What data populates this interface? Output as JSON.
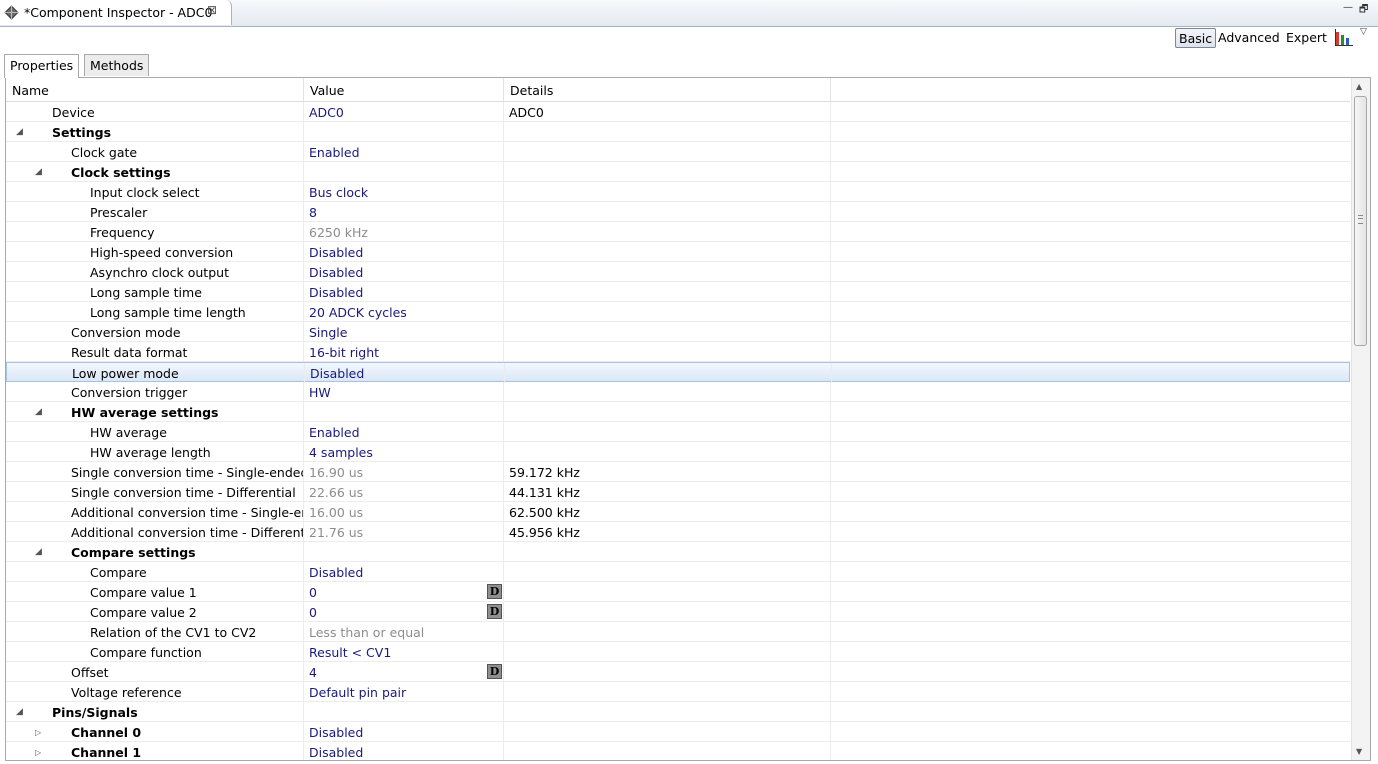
{
  "window": {
    "tab_title": "*Component Inspector - ADC0",
    "close_glyph": "⊠",
    "minimize_glyph": "—",
    "maximize_glyph": "🗗"
  },
  "modes": {
    "basic": "Basic",
    "advanced": "Advanced",
    "expert": "Expert",
    "active": "Basic"
  },
  "subtabs": {
    "properties": "Properties",
    "methods": "Methods"
  },
  "columns": {
    "name": "Name",
    "value": "Value",
    "details": "Details"
  },
  "rows": [
    {
      "name": "Device",
      "level": 2,
      "value": "ADC0",
      "value_style": "edit",
      "details": "ADC0"
    },
    {
      "name": "Settings",
      "level": 2,
      "bold": true,
      "twisty": "open",
      "value": "",
      "details": ""
    },
    {
      "name": "Clock gate",
      "level": 3,
      "value": "Enabled",
      "value_style": "edit",
      "details": ""
    },
    {
      "name": "Clock settings",
      "level": 3,
      "bold": true,
      "twisty": "open",
      "value": "",
      "details": ""
    },
    {
      "name": "Input clock select",
      "level": 4,
      "value": "Bus clock",
      "value_style": "edit",
      "details": ""
    },
    {
      "name": "Prescaler",
      "level": 4,
      "value": "8",
      "value_style": "edit",
      "details": ""
    },
    {
      "name": "Frequency",
      "level": 4,
      "value": "6250 kHz",
      "value_style": "ro",
      "details": ""
    },
    {
      "name": "High-speed conversion",
      "level": 4,
      "value": "Disabled",
      "value_style": "edit",
      "details": ""
    },
    {
      "name": "Asynchro clock output",
      "level": 4,
      "value": "Disabled",
      "value_style": "edit",
      "details": ""
    },
    {
      "name": "Long sample time",
      "level": 4,
      "value": "Disabled",
      "value_style": "edit",
      "details": ""
    },
    {
      "name": "Long sample time length",
      "level": 4,
      "value": "20 ADCK cycles",
      "value_style": "edit",
      "details": ""
    },
    {
      "name": "Conversion mode",
      "level": 3,
      "value": "Single",
      "value_style": "edit",
      "details": ""
    },
    {
      "name": "Result data format",
      "level": 3,
      "value": "16-bit right",
      "value_style": "edit",
      "details": ""
    },
    {
      "name": "Low power mode",
      "level": 3,
      "value": "Disabled",
      "value_style": "edit",
      "details": "",
      "selected": true
    },
    {
      "name": "Conversion trigger",
      "level": 3,
      "value": "HW",
      "value_style": "edit",
      "details": ""
    },
    {
      "name": "HW average settings",
      "level": 3,
      "bold": true,
      "twisty": "open",
      "value": "",
      "details": ""
    },
    {
      "name": "HW average",
      "level": 4,
      "value": "Enabled",
      "value_style": "edit",
      "details": ""
    },
    {
      "name": "HW average length",
      "level": 4,
      "value": "4 samples",
      "value_style": "edit",
      "details": ""
    },
    {
      "name": "Single conversion time - Single-ended",
      "level": 3,
      "value": "16.90 us",
      "value_style": "ro",
      "details": "59.172 kHz"
    },
    {
      "name": "Single conversion time - Differential",
      "level": 3,
      "value": "22.66 us",
      "value_style": "ro",
      "details": "44.131 kHz"
    },
    {
      "name": "Additional conversion time - Single-ended",
      "level": 3,
      "value": "16.00 us",
      "value_style": "ro",
      "details": "62.500 kHz"
    },
    {
      "name": "Additional conversion time - Differential",
      "level": 3,
      "value": "21.76 us",
      "value_style": "ro",
      "details": "45.956 kHz"
    },
    {
      "name": "Compare settings",
      "level": 3,
      "bold": true,
      "twisty": "open",
      "value": "",
      "details": ""
    },
    {
      "name": "Compare",
      "level": 4,
      "value": "Disabled",
      "value_style": "edit",
      "details": ""
    },
    {
      "name": "Compare value 1",
      "level": 4,
      "value": "0",
      "value_style": "edit",
      "details": "",
      "dbutton": "D"
    },
    {
      "name": "Compare value 2",
      "level": 4,
      "value": "0",
      "value_style": "edit",
      "details": "",
      "dbutton": "D"
    },
    {
      "name": "Relation of the CV1 to CV2",
      "level": 4,
      "value": "Less than or equal",
      "value_style": "ro",
      "details": ""
    },
    {
      "name": "Compare function",
      "level": 4,
      "value": "Result < CV1",
      "value_style": "edit",
      "details": ""
    },
    {
      "name": "Offset",
      "level": 3,
      "value": "4",
      "value_style": "edit",
      "details": "",
      "dbutton": "D"
    },
    {
      "name": "Voltage reference",
      "level": 3,
      "value": "Default pin pair",
      "value_style": "edit",
      "details": ""
    },
    {
      "name": "Pins/Signals",
      "level": 2,
      "bold": true,
      "twisty": "open",
      "value": "",
      "details": ""
    },
    {
      "name": "Channel 0",
      "level": 3,
      "bold": true,
      "twisty": "closed",
      "value": "Disabled",
      "value_style": "edit",
      "details": ""
    },
    {
      "name": "Channel 1",
      "level": 3,
      "bold": true,
      "twisty": "closed",
      "value": "Disabled",
      "value_style": "edit",
      "details": ""
    }
  ]
}
